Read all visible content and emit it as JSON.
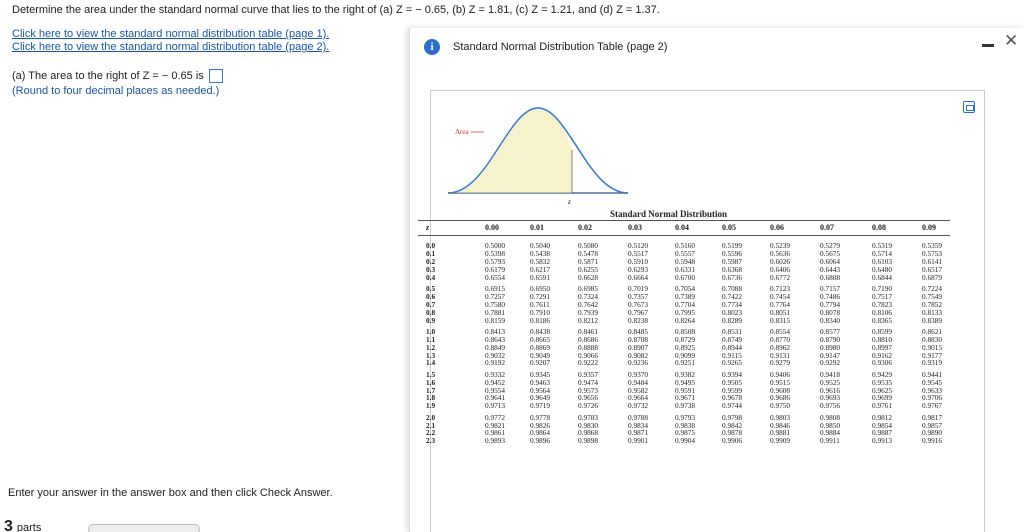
{
  "question": "Determine the area under the standard normal curve that lies to the right of (a) Z = − 0.65, (b) Z = 1.81, (c) Z = 1.21, and (d) Z = 1.37.",
  "links": [
    "Click here to view the standard normal distribution table (page 1).",
    "Click here to view the standard normal distribution table (page 2)."
  ],
  "part_a": {
    "label": "(a) The area to the right of Z = − 0.65 is",
    "answer": "",
    "note": "(Round to four decimal places as needed.)"
  },
  "footer": "Enter your answer in the answer box and then click Check Answer.",
  "parts_label": "parts",
  "parts_count": "3",
  "popup": {
    "title": "Standard Normal Distribution Table (page 2)",
    "info_icon": "info-icon",
    "close_icon": "close-icon",
    "minimize_icon": "minimize-icon"
  },
  "figure": {
    "area_label": "Area",
    "z_label": "z"
  },
  "table": {
    "title": "Standard Normal Distribution",
    "headers": [
      "z",
      "0.00",
      "0.01",
      "0.02",
      "0.03",
      "0.04",
      "0.05",
      "0.06",
      "0.07",
      "0.08",
      "0.09"
    ],
    "rows": [
      [
        "0.0",
        "0.5000",
        "0.5040",
        "0.5080",
        "0.5120",
        "0.5160",
        "0.5199",
        "0.5239",
        "0.5279",
        "0.5319",
        "0.5359"
      ],
      [
        "0.1",
        "0.5398",
        "0.5438",
        "0.5478",
        "0.5517",
        "0.5557",
        "0.5596",
        "0.5636",
        "0.5675",
        "0.5714",
        "0.5753"
      ],
      [
        "0.2",
        "0.5793",
        "0.5832",
        "0.5871",
        "0.5910",
        "0.5948",
        "0.5987",
        "0.6026",
        "0.6064",
        "0.6103",
        "0.6141"
      ],
      [
        "0.3",
        "0.6179",
        "0.6217",
        "0.6255",
        "0.6293",
        "0.6331",
        "0.6368",
        "0.6406",
        "0.6443",
        "0.6480",
        "0.6517"
      ],
      [
        "0.4",
        "0.6554",
        "0.6591",
        "0.6628",
        "0.6664",
        "0.6700",
        "0.6736",
        "0.6772",
        "0.6808",
        "0.6844",
        "0.6879"
      ],
      [
        "0.5",
        "0.6915",
        "0.6950",
        "0.6985",
        "0.7019",
        "0.7054",
        "0.7088",
        "0.7123",
        "0.7157",
        "0.7190",
        "0.7224"
      ],
      [
        "0.6",
        "0.7257",
        "0.7291",
        "0.7324",
        "0.7357",
        "0.7389",
        "0.7422",
        "0.7454",
        "0.7486",
        "0.7517",
        "0.7549"
      ],
      [
        "0.7",
        "0.7580",
        "0.7611",
        "0.7642",
        "0.7673",
        "0.7704",
        "0.7734",
        "0.7764",
        "0.7794",
        "0.7823",
        "0.7852"
      ],
      [
        "0.8",
        "0.7881",
        "0.7910",
        "0.7939",
        "0.7967",
        "0.7995",
        "0.8023",
        "0.8051",
        "0.8078",
        "0.8106",
        "0.8133"
      ],
      [
        "0.9",
        "0.8159",
        "0.8186",
        "0.8212",
        "0.8238",
        "0.8264",
        "0.8289",
        "0.8315",
        "0.8340",
        "0.8365",
        "0.8389"
      ],
      [
        "1.0",
        "0.8413",
        "0.8438",
        "0.8461",
        "0.8485",
        "0.8508",
        "0.8531",
        "0.8554",
        "0.8577",
        "0.8599",
        "0.8621"
      ],
      [
        "1.1",
        "0.8643",
        "0.8665",
        "0.8686",
        "0.8708",
        "0.8729",
        "0.8749",
        "0.8770",
        "0.8790",
        "0.8810",
        "0.8830"
      ],
      [
        "1.2",
        "0.8849",
        "0.8869",
        "0.8888",
        "0.8907",
        "0.8925",
        "0.8944",
        "0.8962",
        "0.8980",
        "0.8997",
        "0.9015"
      ],
      [
        "1.3",
        "0.9032",
        "0.9049",
        "0.9066",
        "0.9082",
        "0.9099",
        "0.9115",
        "0.9131",
        "0.9147",
        "0.9162",
        "0.9177"
      ],
      [
        "1.4",
        "0.9192",
        "0.9207",
        "0.9222",
        "0.9236",
        "0.9251",
        "0.9265",
        "0.9279",
        "0.9292",
        "0.9306",
        "0.9319"
      ],
      [
        "1.5",
        "0.9332",
        "0.9345",
        "0.9357",
        "0.9370",
        "0.9382",
        "0.9394",
        "0.9406",
        "0.9418",
        "0.9429",
        "0.9441"
      ],
      [
        "1.6",
        "0.9452",
        "0.9463",
        "0.9474",
        "0.9484",
        "0.9495",
        "0.9505",
        "0.9515",
        "0.9525",
        "0.9535",
        "0.9545"
      ],
      [
        "1.7",
        "0.9554",
        "0.9564",
        "0.9573",
        "0.9582",
        "0.9591",
        "0.9599",
        "0.9608",
        "0.9616",
        "0.9625",
        "0.9633"
      ],
      [
        "1.8",
        "0.9641",
        "0.9649",
        "0.9656",
        "0.9664",
        "0.9671",
        "0.9678",
        "0.9686",
        "0.9693",
        "0.9699",
        "0.9706"
      ],
      [
        "1.9",
        "0.9713",
        "0.9719",
        "0.9726",
        "0.9732",
        "0.9738",
        "0.9744",
        "0.9750",
        "0.9756",
        "0.9761",
        "0.9767"
      ],
      [
        "2.0",
        "0.9772",
        "0.9778",
        "0.9783",
        "0.9788",
        "0.9793",
        "0.9798",
        "0.9803",
        "0.9808",
        "0.9812",
        "0.9817"
      ],
      [
        "2.1",
        "0.9821",
        "0.9826",
        "0.9830",
        "0.9834",
        "0.9838",
        "0.9842",
        "0.9846",
        "0.9850",
        "0.9854",
        "0.9857"
      ],
      [
        "2.2",
        "0.9861",
        "0.9864",
        "0.9868",
        "0.9871",
        "0.9875",
        "0.9878",
        "0.9881",
        "0.9884",
        "0.9887",
        "0.9890"
      ],
      [
        "2.3",
        "0.9893",
        "0.9896",
        "0.9898",
        "0.9901",
        "0.9904",
        "0.9906",
        "0.9909",
        "0.9911",
        "0.9913",
        "0.9916"
      ]
    ]
  }
}
